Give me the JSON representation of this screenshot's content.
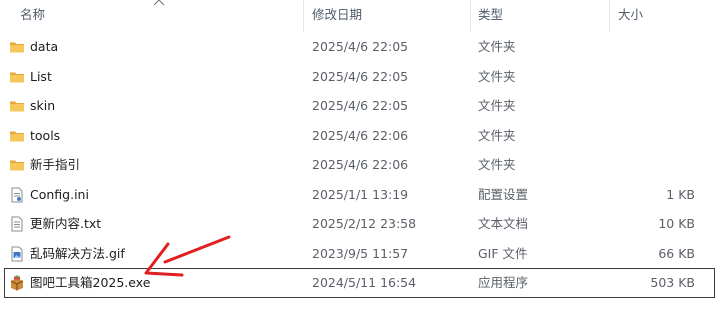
{
  "columns": {
    "name": "名称",
    "date": "修改日期",
    "type": "类型",
    "size": "大小"
  },
  "files": [
    {
      "name": "data",
      "date": "2025/4/6 22:05",
      "type": "文件夹",
      "size": "",
      "icon": "folder-icon"
    },
    {
      "name": "List",
      "date": "2025/4/6 22:05",
      "type": "文件夹",
      "size": "",
      "icon": "folder-icon"
    },
    {
      "name": "skin",
      "date": "2025/4/6 22:05",
      "type": "文件夹",
      "size": "",
      "icon": "folder-icon"
    },
    {
      "name": "tools",
      "date": "2025/4/6 22:06",
      "type": "文件夹",
      "size": "",
      "icon": "folder-icon"
    },
    {
      "name": "新手指引",
      "date": "2025/4/6 22:06",
      "type": "文件夹",
      "size": "",
      "icon": "folder-icon"
    },
    {
      "name": "Config.ini",
      "date": "2025/1/1 13:19",
      "type": "配置设置",
      "size": "1 KB",
      "icon": "config-file-icon"
    },
    {
      "name": "更新内容.txt",
      "date": "2025/2/12 23:58",
      "type": "文本文档",
      "size": "10 KB",
      "icon": "text-file-icon"
    },
    {
      "name": "乱码解决方法.gif",
      "date": "2023/9/5 11:57",
      "type": "GIF 文件",
      "size": "66 KB",
      "icon": "image-file-icon"
    },
    {
      "name": "图吧工具箱2025.exe",
      "date": "2024/5/11 16:54",
      "type": "应用程序",
      "size": "503 KB",
      "icon": "app-package-icon",
      "selected": true
    }
  ],
  "annotation": {
    "color": "#e02020",
    "icon": "red-arrow-annotation"
  },
  "colors": {
    "folder": "#f2c14e",
    "selection_border": "#3a3a3a",
    "header_text": "#4f5b6a"
  }
}
